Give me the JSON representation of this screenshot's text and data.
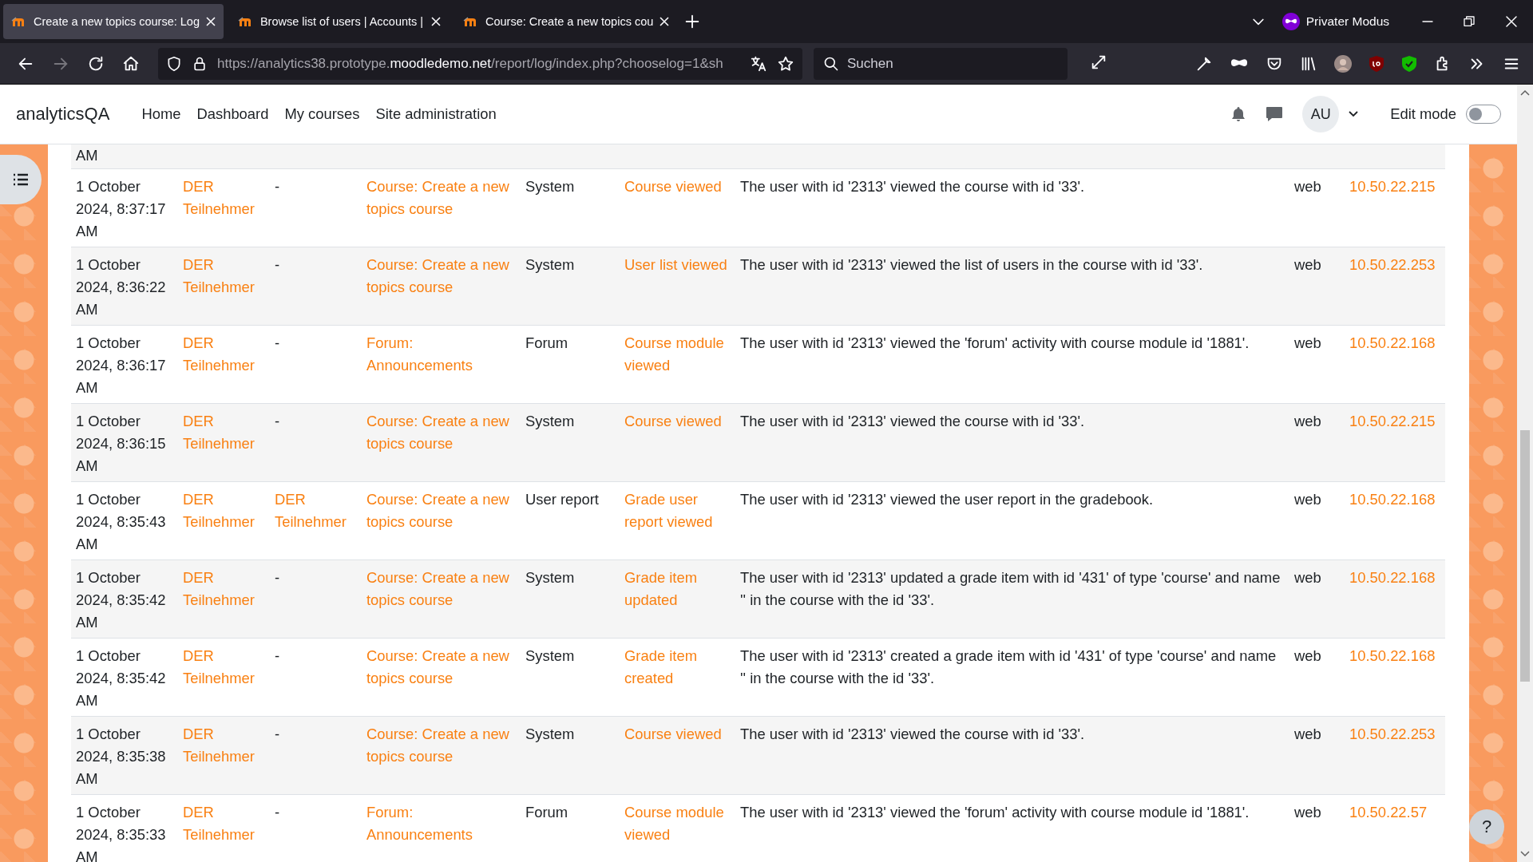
{
  "browser": {
    "tabs": [
      {
        "title": "Create a new topics course: Log",
        "selected": true
      },
      {
        "title": "Browse list of users | Accounts |",
        "selected": false
      },
      {
        "title": "Course: Create a new topics cou",
        "selected": false
      }
    ],
    "private_label": "Privater Modus",
    "url": {
      "prefix": "https://analytics38.prototype.",
      "domain": "moodledemo.net",
      "path": "/report/log/index.php?chooselog=1&sh"
    },
    "search": {
      "placeholder": "Suchen"
    }
  },
  "navbar": {
    "brand": "analyticsQA",
    "links": [
      "Home",
      "Dashboard",
      "My courses",
      "Site administration"
    ],
    "avatar": "AU",
    "edit_mode": {
      "label": "Edit mode",
      "on": false
    }
  },
  "log_table": {
    "partial_row": {
      "time": "AM"
    },
    "rows": [
      {
        "time": "1 October 2024, 8:37:17 AM",
        "user": "DER Teilnehmer",
        "affected_user": "-",
        "context": "Course: Create a new topics course",
        "component": "System",
        "event": "Course viewed",
        "description": "The user with id '2313' viewed the course with id '33'.",
        "origin": "web",
        "ip": "10.50.22.215"
      },
      {
        "time": "1 October 2024, 8:36:22 AM",
        "user": "DER Teilnehmer",
        "affected_user": "-",
        "context": "Course: Create a new topics course",
        "component": "System",
        "event": "User list viewed",
        "description": "The user with id '2313' viewed the list of users in the course with id '33'.",
        "origin": "web",
        "ip": "10.50.22.253"
      },
      {
        "time": "1 October 2024, 8:36:17 AM",
        "user": "DER Teilnehmer",
        "affected_user": "-",
        "context": "Forum: Announcements",
        "component": "Forum",
        "event": "Course module viewed",
        "description": "The user with id '2313' viewed the 'forum' activity with course module id '1881'.",
        "origin": "web",
        "ip": "10.50.22.168"
      },
      {
        "time": "1 October 2024, 8:36:15 AM",
        "user": "DER Teilnehmer",
        "affected_user": "-",
        "context": "Course: Create a new topics course",
        "component": "System",
        "event": "Course viewed",
        "description": "The user with id '2313' viewed the course with id '33'.",
        "origin": "web",
        "ip": "10.50.22.215"
      },
      {
        "time": "1 October 2024, 8:35:43 AM",
        "user": "DER Teilnehmer",
        "affected_user": "DER Teilnehmer",
        "context": "Course: Create a new topics course",
        "component": "User report",
        "event": "Grade user report viewed",
        "description": "The user with id '2313' viewed the user report in the gradebook.",
        "origin": "web",
        "ip": "10.50.22.168"
      },
      {
        "time": "1 October 2024, 8:35:42 AM",
        "user": "DER Teilnehmer",
        "affected_user": "-",
        "context": "Course: Create a new topics course",
        "component": "System",
        "event": "Grade item updated",
        "description": "The user with id '2313' updated a grade item with id '431' of type 'course' and name '' in the course with the id '33'.",
        "origin": "web",
        "ip": "10.50.22.168"
      },
      {
        "time": "1 October 2024, 8:35:42 AM",
        "user": "DER Teilnehmer",
        "affected_user": "-",
        "context": "Course: Create a new topics course",
        "component": "System",
        "event": "Grade item created",
        "description": "The user with id '2313' created a grade item with id '431' of type 'course' and name '' in the course with the id '33'.",
        "origin": "web",
        "ip": "10.50.22.168"
      },
      {
        "time": "1 October 2024, 8:35:38 AM",
        "user": "DER Teilnehmer",
        "affected_user": "-",
        "context": "Course: Create a new topics course",
        "component": "System",
        "event": "Course viewed",
        "description": "The user with id '2313' viewed the course with id '33'.",
        "origin": "web",
        "ip": "10.50.22.253"
      },
      {
        "time": "1 October 2024, 8:35:33 AM",
        "user": "DER Teilnehmer",
        "affected_user": "-",
        "context": "Forum: Announcements",
        "component": "Forum",
        "event": "Course module viewed",
        "description": "The user with id '2313' viewed the 'forum' activity with course module id '1881'.",
        "origin": "web",
        "ip": "10.50.22.57"
      }
    ]
  },
  "help_button": "?"
}
